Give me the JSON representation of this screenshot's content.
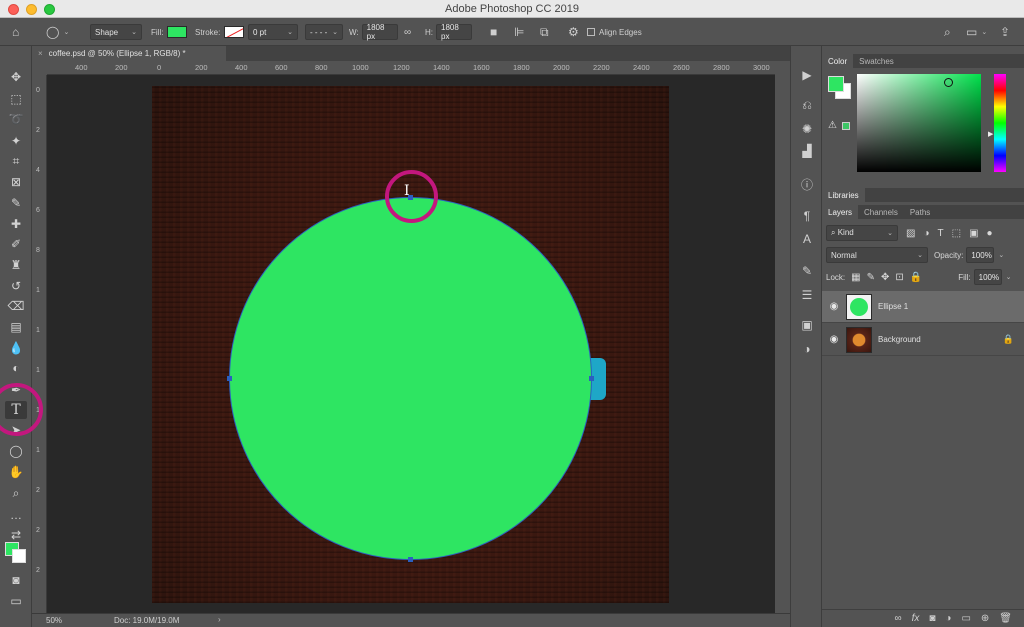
{
  "app": {
    "title": "Adobe Photoshop CC 2019"
  },
  "options_bar": {
    "mode_label": "Shape",
    "fill_label": "Fill:",
    "stroke_label": "Stroke:",
    "stroke_width": "0 pt",
    "w_label": "W:",
    "w_value": "1808 px",
    "h_label": "H:",
    "h_value": "1808 px",
    "align_edges_label": "Align Edges"
  },
  "document": {
    "tab_title": "coffee.psd @ 50% (Ellipse 1, RGB/8) *",
    "zoom": "50%",
    "doc_size": "Doc: 19.0M/19.0M"
  },
  "ruler": {
    "top_ticks": [
      "400",
      "200",
      "0",
      "200",
      "400",
      "600",
      "800",
      "1000",
      "1200",
      "1400",
      "1600",
      "1800",
      "2000",
      "2200",
      "2400",
      "2600",
      "2800",
      "3000"
    ],
    "left_ticks": [
      "0",
      "2",
      "4",
      "6",
      "8",
      "1",
      "1",
      "1",
      "1",
      "1",
      "2",
      "2",
      "2"
    ]
  },
  "panels": {
    "color_tab": "Color",
    "swatches_tab": "Swatches",
    "libraries_tab": "Libraries",
    "layers_tab": "Layers",
    "channels_tab": "Channels",
    "paths_tab": "Paths",
    "kind_label": "Kind",
    "blend_mode": "Normal",
    "opacity_label": "Opacity:",
    "opacity_value": "100%",
    "lock_label": "Lock:",
    "fill_label": "Fill:",
    "fill_value": "100%",
    "layers": [
      {
        "name": "Ellipse 1"
      },
      {
        "name": "Background"
      }
    ]
  },
  "colors": {
    "shape_fill": "#2ee562",
    "highlight": "#c3177e",
    "path": "#2b5fbf"
  }
}
